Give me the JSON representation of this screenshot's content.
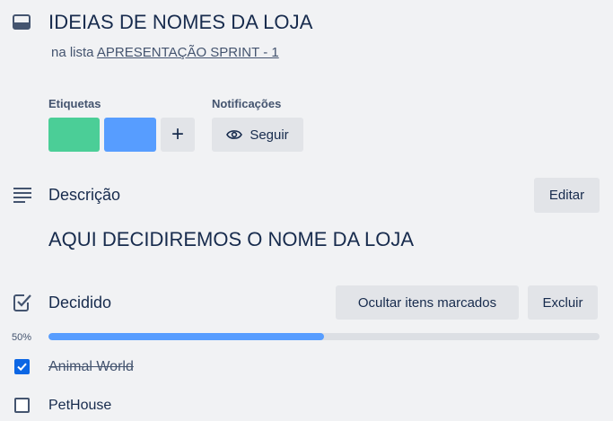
{
  "card": {
    "title": "IDEIAS DE NOMES DA LOJA",
    "list_prefix": "na lista",
    "list_name": "APRESENTAÇÃO SPRINT - 1"
  },
  "labels": {
    "heading": "Etiquetas",
    "chips": [
      {
        "color": "#4bce97"
      },
      {
        "color": "#579dff"
      }
    ],
    "add_symbol": "+"
  },
  "notifications": {
    "heading": "Notificações",
    "follow_label": "Seguir",
    "follow_icon": "eye-icon"
  },
  "description": {
    "heading": "Descrição",
    "edit_label": "Editar",
    "text": "AQUI DECIDIREMOS O NOME DA LOJA"
  },
  "checklist": {
    "heading": "Decidido",
    "hide_label": "Ocultar itens marcados",
    "delete_label": "Excluir",
    "progress_text": "50%",
    "progress": 0.5,
    "progress_color": "#579dff",
    "items": [
      {
        "text": "Animal World",
        "checked": true
      },
      {
        "text": "PetHouse",
        "checked": false
      }
    ]
  }
}
